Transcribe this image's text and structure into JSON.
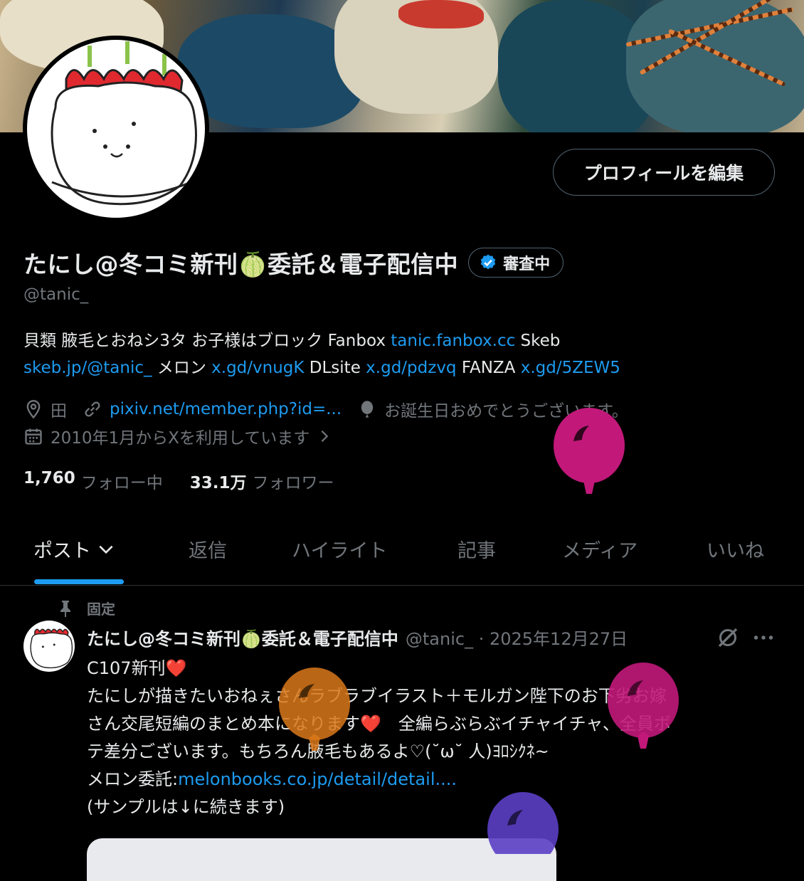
{
  "profile": {
    "edit_button": "プロフィールを編集",
    "name": "たにし@冬コミ新刊🍈委託＆電子配信中",
    "badge_label": "審査中",
    "handle": "@tanic_",
    "bio": {
      "t1": "貝類 腋毛とおねシ3タ お子様はブロック Fanbox ",
      "l1": "tanic.fanbox.cc",
      "t2": " Skeb",
      "l2": "skeb.jp/@tanic_",
      "t3": " メロン ",
      "l3": "x.gd/vnugK",
      "t4": " DLsite ",
      "l4": "x.gd/pdzvq",
      "t5": " FANZA ",
      "l5": "x.gd/5ZEW5"
    },
    "location": "田",
    "website": "pixiv.net/member.php?id=...",
    "birthday": "お誕生日おめでとうございます。",
    "joined": "2010年1月からXを利用しています",
    "following_count": "1,760",
    "following_label": "フォロー中",
    "followers_count": "33.1万",
    "followers_label": "フォロワー"
  },
  "tabs": [
    "ポスト",
    "返信",
    "ハイライト",
    "記事",
    "メディア",
    "いいね"
  ],
  "pinned_post": {
    "pinned_label": "固定",
    "author": "たにし@冬コミ新刊🍈委託＆電子配信中",
    "handle_date": "@tanic_ · 2025年12月27日",
    "lines": {
      "l1": "C107新刊❤️",
      "l2": "たにしが描きたいおねぇさんラブラブイラスト＋モルガン陛下のお下劣お嫁",
      "l3": "さん交尾短編のまとめ本になります❤️　全編らぶらぶイチャイチャ、全員ボ",
      "l4": "テ差分ございます。もちろん腋毛もあるよ♡(˘ω˘ 人)ﾖﾛｼｸﾈ~",
      "l5_text": "メロン委託:",
      "l5_link": "melonbooks.co.jp/detail/detail....",
      "l6": "(サンプルは↓に続きます)"
    }
  },
  "colors": {
    "accent": "#1d9bf0",
    "muted": "#71767b",
    "balloon_magenta": "#c2187a",
    "balloon_orange": "#d9781a",
    "balloon_purple": "#5b3fc4"
  }
}
